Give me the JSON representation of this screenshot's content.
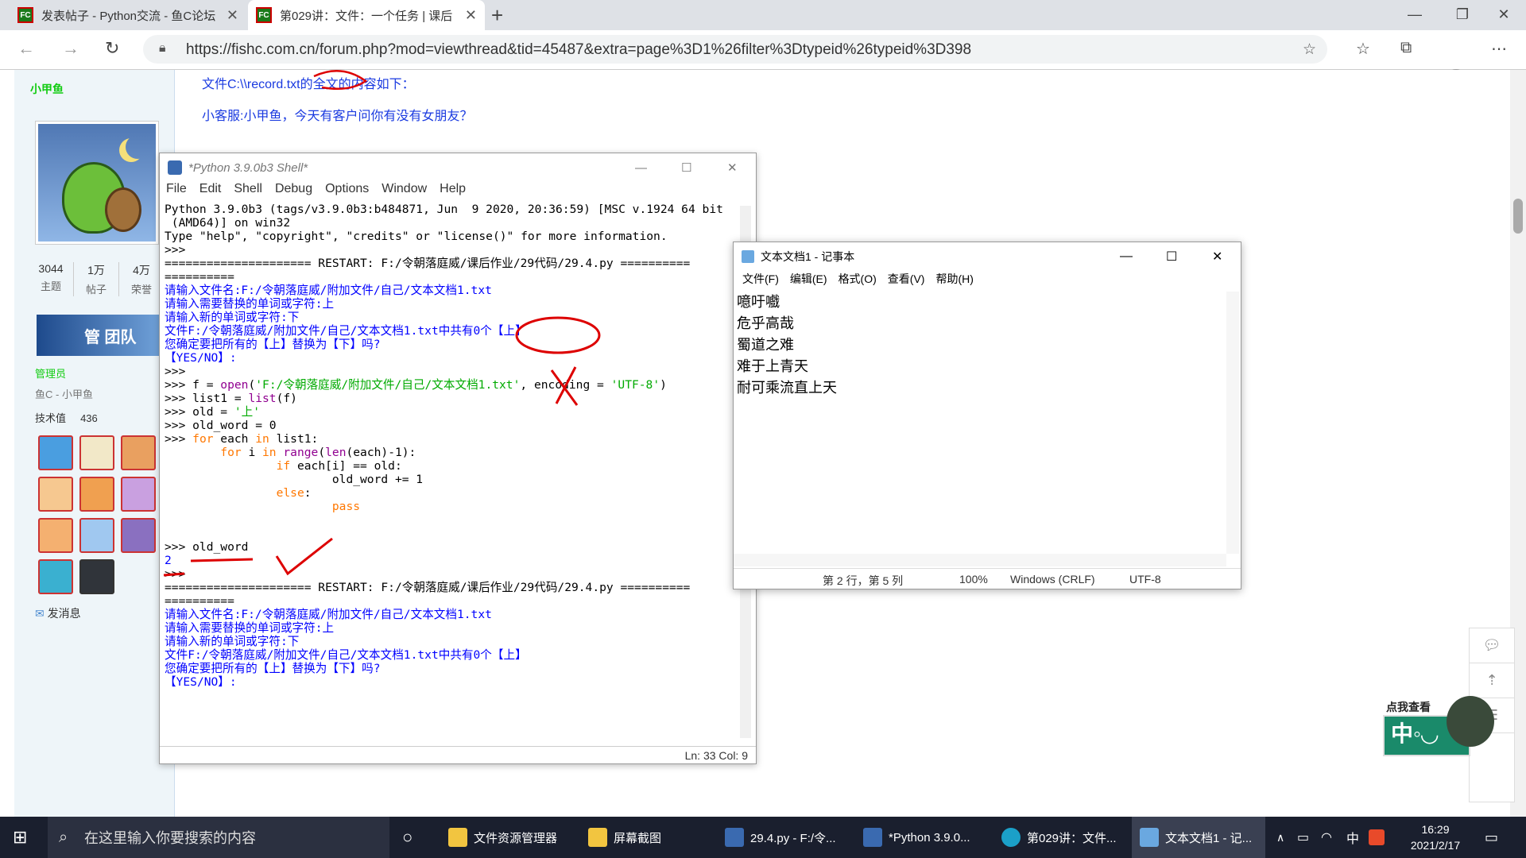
{
  "browser": {
    "tabs": [
      {
        "title": "发表帖子 - Python交流 - 鱼C论坛",
        "fav": "FC"
      },
      {
        "title": "第029讲：文件：一个任务 | 课后",
        "fav": "FC"
      }
    ],
    "url": "https://fishc.com.cn/forum.php?mod=viewthread&tid=45487&extra=page%3D1%26filter%3Dtypeid%26typeid%3D398"
  },
  "sidebar": {
    "username": "小甲鱼",
    "stats": [
      {
        "value": "3044",
        "label": "主题"
      },
      {
        "value": "1万",
        "label": "帖子"
      },
      {
        "value": "4万",
        "label": "荣誉"
      }
    ],
    "badge_text": "管 团队",
    "role": "管理员",
    "subrole": "鱼C - 小甲鱼",
    "tech_label": "技术值",
    "tech_value": "436",
    "send_msg": "发消息"
  },
  "post": {
    "line1": "文件C:\\\\record.txt的全文的内容如下：",
    "line2": "小客服:小甲鱼，今天有客户问你有没有女朋友？"
  },
  "idle": {
    "title": "*Python 3.9.0b3 Shell*",
    "menu": [
      "File",
      "Edit",
      "Shell",
      "Debug",
      "Options",
      "Window",
      "Help"
    ],
    "status": "Ln: 33   Col: 9"
  },
  "notepad": {
    "title": "文本文档1 - 记事本",
    "menu": [
      "文件(F)",
      "编辑(E)",
      "格式(O)",
      "查看(V)",
      "帮助(H)"
    ],
    "lines": [
      "噫吁嚱",
      "危乎高哉",
      "蜀道之难",
      "难于上青天",
      "耐可乘流直上天"
    ],
    "status_pos": "第 2 行，第 5 列",
    "status_zoom": "100%",
    "status_eol": "Windows (CRLF)",
    "status_enc": "UTF-8"
  },
  "promo": {
    "text": "点我查看"
  },
  "taskbar": {
    "search": "在这里输入你要搜索的内容",
    "items": [
      "文件资源管理器",
      "屏幕截图",
      "29.4.py - F:/令...",
      "*Python 3.9.0...",
      "第029讲：文件...",
      "文本文档1 - 记..."
    ],
    "ime": "中",
    "time": "16:29",
    "date": "2021/2/17"
  }
}
